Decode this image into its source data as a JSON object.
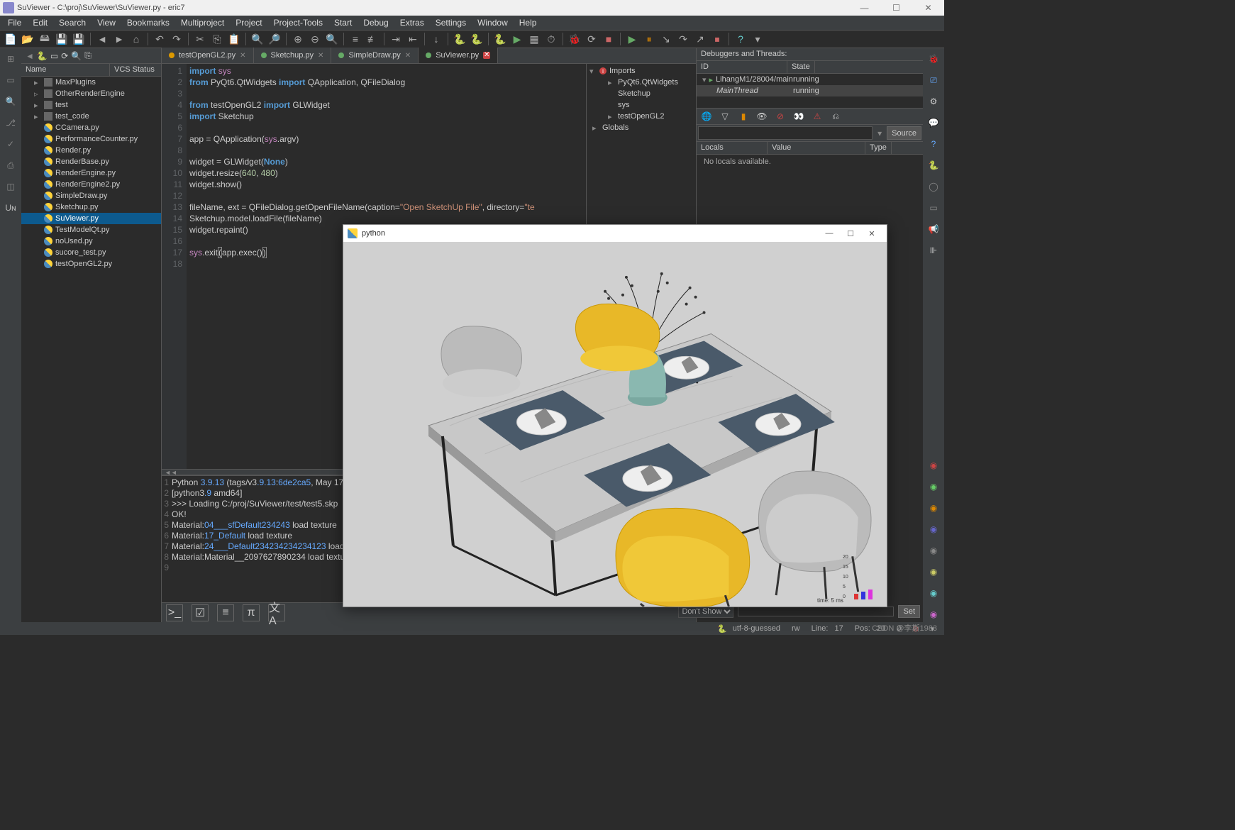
{
  "window": {
    "title": "SuViewer - C:\\proj\\SuViewer\\SuViewer.py - eric7"
  },
  "menu": [
    "File",
    "Edit",
    "Search",
    "View",
    "Bookmarks",
    "Multiproject",
    "Project",
    "Project-Tools",
    "Start",
    "Debug",
    "Extras",
    "Settings",
    "Window",
    "Help"
  ],
  "filetree": {
    "col1": "Name",
    "col2": "VCS Status",
    "items": [
      {
        "type": "folder",
        "name": "MaxPlugins",
        "exp": true
      },
      {
        "type": "folder",
        "name": "OtherRenderEngine",
        "exp": false
      },
      {
        "type": "folder",
        "name": "test",
        "exp": true
      },
      {
        "type": "folder",
        "name": "test_code",
        "exp": true
      },
      {
        "type": "py",
        "name": "CCamera.py"
      },
      {
        "type": "py",
        "name": "PerformanceCounter.py"
      },
      {
        "type": "py",
        "name": "Render.py"
      },
      {
        "type": "py",
        "name": "RenderBase.py"
      },
      {
        "type": "py",
        "name": "RenderEngine.py"
      },
      {
        "type": "py",
        "name": "RenderEngine2.py"
      },
      {
        "type": "py",
        "name": "SimpleDraw.py"
      },
      {
        "type": "py",
        "name": "Sketchup.py"
      },
      {
        "type": "py",
        "name": "SuViewer.py",
        "selected": true
      },
      {
        "type": "py",
        "name": "TestModelQt.py"
      },
      {
        "type": "py",
        "name": "noUsed.py"
      },
      {
        "type": "py",
        "name": "sucore_test.py"
      },
      {
        "type": "py",
        "name": "testOpenGL2.py"
      }
    ]
  },
  "tabs": [
    {
      "name": "testOpenGL2.py",
      "warn": true,
      "close": true
    },
    {
      "name": "Sketchup.py",
      "close": true
    },
    {
      "name": "SimpleDraw.py",
      "close": true
    },
    {
      "name": "SuViewer.py",
      "active": true,
      "mod": true
    }
  ],
  "code": [
    {
      "n": 1,
      "html": "<span class='kw'>import</span> <span class='self'>sys</span>"
    },
    {
      "n": 2,
      "html": "<span class='kw'>from</span> PyQt6.QtWidgets <span class='kw'>import</span> QApplication, QFileDialog"
    },
    {
      "n": 3,
      "html": ""
    },
    {
      "n": 4,
      "html": "<span class='kw'>from</span> testOpenGL2 <span class='kw'>import</span> GLWidget"
    },
    {
      "n": 5,
      "html": "<span class='kw'>import</span> Sketchup"
    },
    {
      "n": 6,
      "html": ""
    },
    {
      "n": 7,
      "html": "app = QApplication(<span class='self'>sys</span>.argv)"
    },
    {
      "n": 8,
      "html": ""
    },
    {
      "n": 9,
      "html": "widget = GLWidget(<span class='kw'>None</span>)"
    },
    {
      "n": 10,
      "html": "widget.resize(<span class='num'>640</span>, <span class='num'>480</span>)"
    },
    {
      "n": 11,
      "html": "widget.show()"
    },
    {
      "n": 12,
      "html": ""
    },
    {
      "n": 13,
      "html": "fileName, ext = QFileDialog.getOpenFileName(caption=<span class='str'>\"Open SketchUp File\"</span>, directory=<span class='str'>\"te</span>"
    },
    {
      "n": 14,
      "html": "Sketchup.model.loadFile(fileName)"
    },
    {
      "n": 15,
      "html": "widget.repaint()"
    },
    {
      "n": 16,
      "html": ""
    },
    {
      "n": 17,
      "html": "<span class='self'>sys</span>.exit<span class='cursor'>(</span>app.exec()<span class='cursor'>)</span>"
    },
    {
      "n": 18,
      "html": ""
    }
  ],
  "console": [
    {
      "n": 1,
      "html": "Python <span class='bl'>3.9.13</span> (tags/v3<span class='bl'>.9.13</span>:<span class='bl'>6de2ca5</span>, May 17"
    },
    {
      "n": 2,
      "html": "[python3<span class='bl'>.9</span> amd64]"
    },
    {
      "n": 3,
      "html": ">>> Loading C:/proj/SuViewer/test/test5.skp"
    },
    {
      "n": 4,
      "html": "OK!"
    },
    {
      "n": 5,
      "html": "Material:<span class='bl'>04___sfDefault234243</span> load texture"
    },
    {
      "n": 6,
      "html": "Material:<span class='bl'>17_Default</span> load texture"
    },
    {
      "n": 7,
      "html": "Material:<span class='bl'>24___Default234234234234123</span> load te"
    },
    {
      "n": 8,
      "html": "Material:Material__2097627890234 load texture"
    },
    {
      "n": 9,
      "html": ""
    }
  ],
  "outline": {
    "items": [
      {
        "name": "Imports",
        "root": true
      },
      {
        "name": "PyQt6.QtWidgets",
        "sub": true,
        "exp": true
      },
      {
        "name": "Sketchup",
        "sub": true
      },
      {
        "name": "sys",
        "sub": true
      },
      {
        "name": "testOpenGL2",
        "sub": true,
        "exp": true
      },
      {
        "name": "Globals",
        "root": true
      }
    ]
  },
  "debugger": {
    "title": "Debuggers and Threads:",
    "col1": "ID",
    "col2": "State",
    "threads": [
      {
        "name": "LihangM1/28004/main",
        "state": "running",
        "exp": true
      },
      {
        "name": "MainThread",
        "state": "running",
        "indent": true
      }
    ],
    "src_btn": "Source",
    "vcol1": "Locals",
    "vcol2": "Value",
    "vcol3": "Type",
    "nolocals": "No locals available."
  },
  "pywin": {
    "title": "python"
  },
  "chart_data": {
    "type": "bar",
    "categories": [
      "red",
      "blue",
      "magenta"
    ],
    "values": [
      3,
      4,
      5
    ],
    "ticks": [
      0,
      5,
      10,
      15,
      20
    ],
    "colors": [
      "#d33",
      "#33d",
      "#d3d"
    ],
    "caption": "time:  5 ms"
  },
  "status": {
    "encoding": "utf-8-guessed",
    "rw": "rw",
    "line_lbl": "Line:",
    "line": "17",
    "pos_lbl": "Pos:",
    "pos": "20",
    "zero": "0"
  },
  "dontshow": "Don't Show",
  "setbtn": "Set",
  "watermark": "CSDN @李斯1983"
}
